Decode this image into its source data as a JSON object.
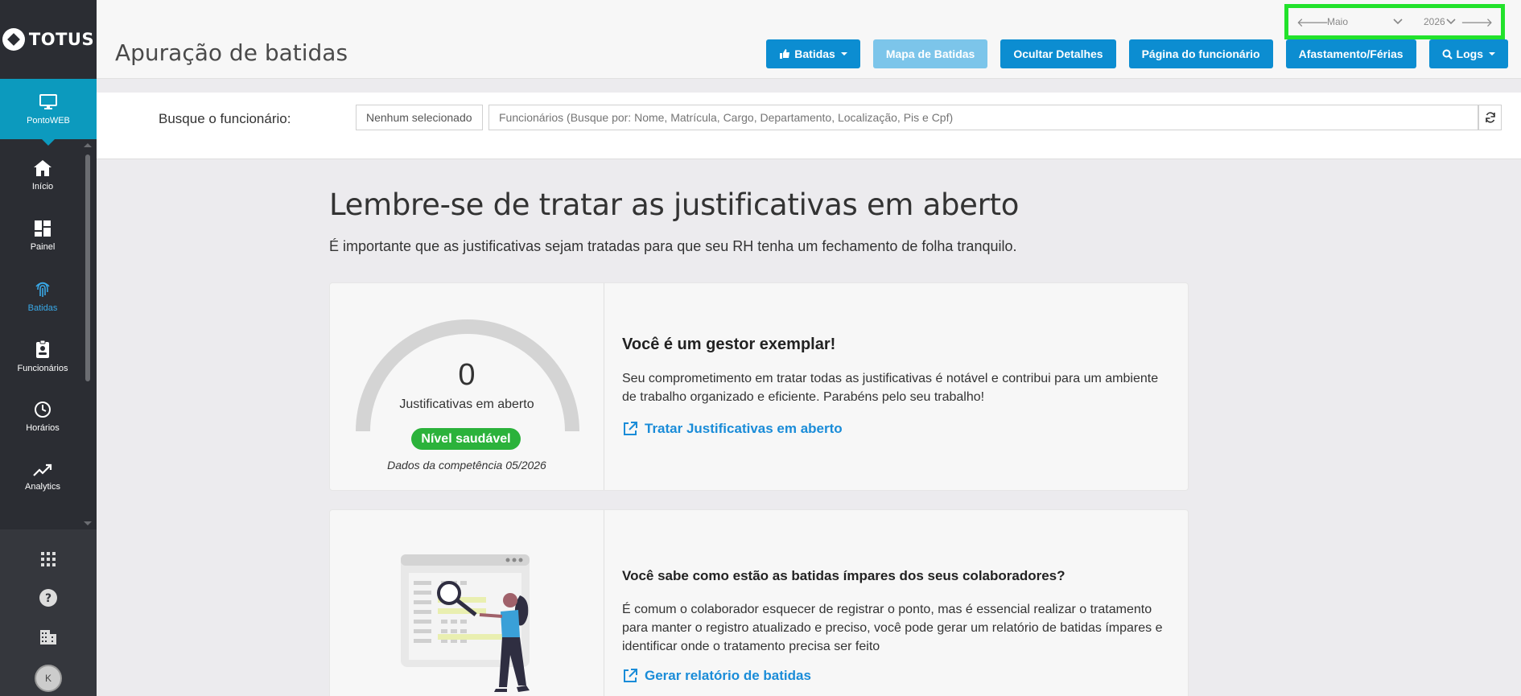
{
  "sidebar": {
    "brand": "TOTUS",
    "active_module": {
      "label": "PontoWEB",
      "icon": "monitor-icon"
    },
    "items": [
      {
        "label": "Início",
        "icon": "home-icon"
      },
      {
        "label": "Painel",
        "icon": "dashboard-icon"
      },
      {
        "label": "Batidas",
        "icon": "fingerprint-icon",
        "selected": true
      },
      {
        "label": "Funcionários",
        "icon": "badge-icon"
      },
      {
        "label": "Horários",
        "icon": "clock-icon"
      },
      {
        "label": "Analytics",
        "icon": "trending-up-icon"
      }
    ],
    "bottom_icons": [
      "apps-grid-icon",
      "help-icon",
      "building-icon"
    ],
    "avatar_initial": "K"
  },
  "header": {
    "title": "Apuração de batidas",
    "date_nav": {
      "month": "Maio",
      "year": "2026"
    },
    "buttons": {
      "batidas": "Batidas",
      "mapa": "Mapa de Batidas",
      "ocultar": "Ocultar Detalhes",
      "pagina": "Página do funcionário",
      "afastamento": "Afastamento/Férias",
      "logs": "Logs"
    }
  },
  "search": {
    "label": "Busque o funcionário:",
    "selected": "Nenhum selecionado",
    "placeholder": "Funcionários (Busque por: Nome, Matrícula, Cargo, Departamento, Localização, Pis e Cpf)"
  },
  "main": {
    "title": "Lembre-se de tratar as justificativas em aberto",
    "subtitle": "É importante que as justificativas sejam tratadas para que seu RH tenha um fechamento de folha tranquilo.",
    "card1": {
      "gauge_value": "0",
      "gauge_fraction": 0,
      "gauge_label": "Justificativas em aberto",
      "badge": "Nível saudável",
      "competence": "Dados da competência 05/2026",
      "heading": "Você é um gestor exemplar!",
      "text": "Seu comprometimento em tratar todas as justificativas é notável e contribui para um ambiente de trabalho organizado e eficiente. Parabéns pelo seu trabalho!",
      "link": "Tratar Justificativas em aberto"
    },
    "card2": {
      "heading": "Você sabe como estão as batidas ímpares dos seus colaboradores?",
      "text": "É comum o colaborador esquecer de registrar o ponto, mas é essencial realizar o tratamento para manter o registro atualizado e preciso, você pode gerar um relatório de batidas ímpares e identificar onde o tratamento precisa ser feito",
      "link": "Gerar relatório de batidas"
    }
  },
  "colors": {
    "sidebar_bg": "#2b2d33",
    "active_module_bg": "#0c9abe",
    "primary_button": "#0c8dd1",
    "light_button": "#7cc5ea",
    "highlight_border": "#22e22b",
    "healthy_badge": "#2bb23b",
    "link": "#1a8cd8"
  }
}
